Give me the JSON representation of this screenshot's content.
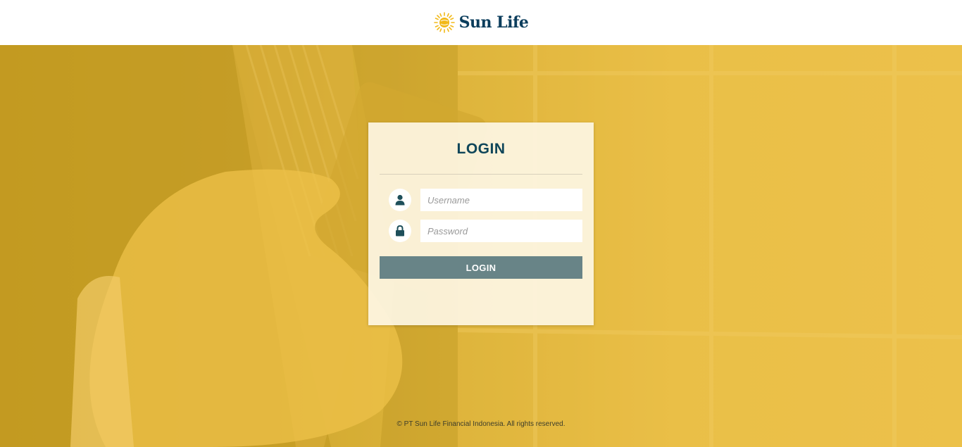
{
  "header": {
    "brand_name": "Sun Life",
    "logo_icon": "sun-logo-icon"
  },
  "login": {
    "title": "LOGIN",
    "username": {
      "placeholder": "Username",
      "value": "",
      "icon": "user-icon"
    },
    "password": {
      "placeholder": "Password",
      "value": "",
      "icon": "lock-icon"
    },
    "submit_label": "LOGIN"
  },
  "footer": {
    "copyright": "© PT Sun Life Financial Indonesia. All rights reserved."
  },
  "colors": {
    "brand_navy": "#0b3d5c",
    "brand_yellow": "#f2b919",
    "button": "#688487",
    "hero_overlay": "#e6b93e"
  }
}
